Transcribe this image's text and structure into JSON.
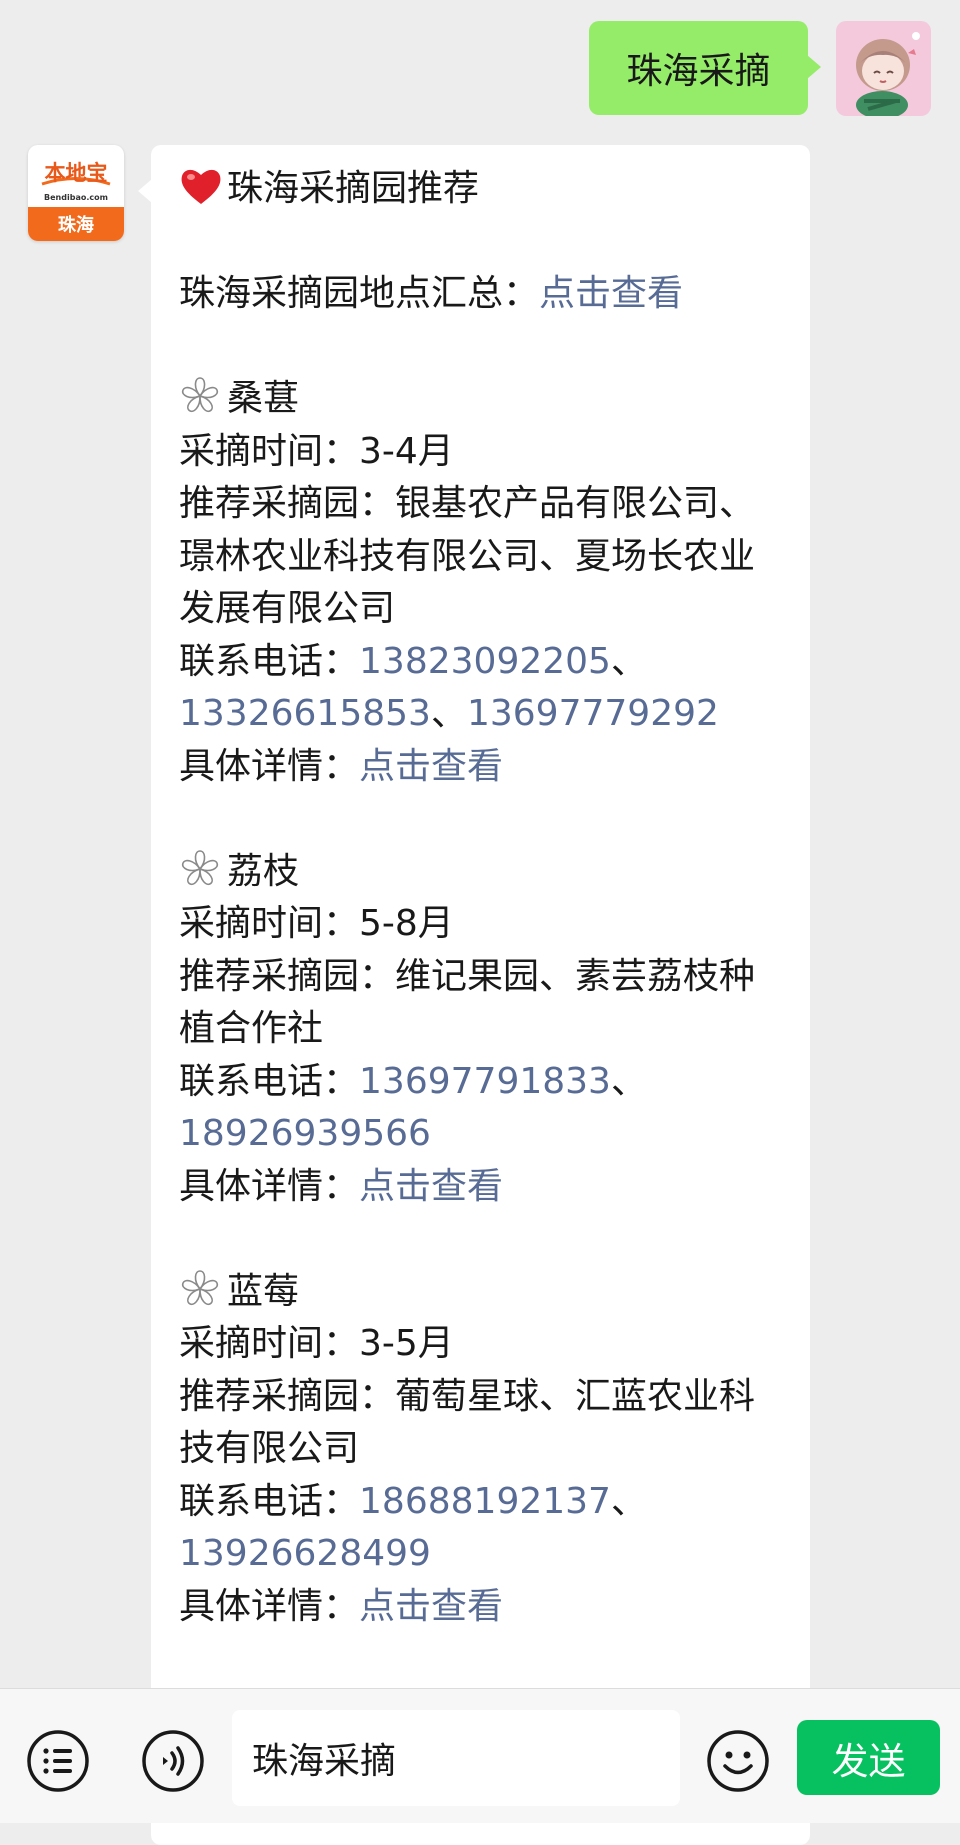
{
  "outgoing": {
    "text": "珠海采摘"
  },
  "bot": {
    "logo_top": "本地宝",
    "logo_domain": "Bendibao.com",
    "logo_city": "珠海"
  },
  "message": {
    "title": "珠海采摘园推荐",
    "summary_label": "珠海采摘园地点汇总：",
    "summary_link": "点击查看",
    "fruits": [
      {
        "name": "桑葚",
        "time": "采摘时间：3-4月",
        "garden": "推荐采摘园：银基农产品有限公司、璟林农业科技有限公司、夏场长农业发展有限公司",
        "phone_label": "联系电话：",
        "phones": [
          "13823092205",
          "13326615853",
          "13697779292"
        ],
        "detail_label": "具体详情：",
        "detail_link": "点击查看"
      },
      {
        "name": "荔枝",
        "time": "采摘时间：5-8月",
        "garden": "推荐采摘园：维记果园、素芸荔枝种植合作社",
        "phone_label": "联系电话：",
        "phones": [
          "13697791833",
          "18926939566"
        ],
        "detail_label": "具体详情：",
        "detail_link": "点击查看"
      },
      {
        "name": "蓝莓",
        "time": "采摘时间：3-5月",
        "garden": "推荐采摘园：葡萄星球、汇蓝农业科技有限公司",
        "phone_label": "联系电话：",
        "phones": [
          "18688192137",
          "13926628499"
        ],
        "detail_label": "具体详情：",
        "detail_link": "点击查看"
      }
    ],
    "separator": "、"
  },
  "input_bar": {
    "value": "珠海采摘",
    "send_label": "发送"
  },
  "colors": {
    "link": "#576b95",
    "outgoing_bubble": "#95ec69",
    "send": "#07c160",
    "logo_orange": "#f26b1d"
  },
  "icons": {
    "menu": "list-menu-icon",
    "voice": "voice-icon",
    "emoji": "emoji-icon",
    "heart": "heart-icon",
    "flower": "flower-icon"
  }
}
